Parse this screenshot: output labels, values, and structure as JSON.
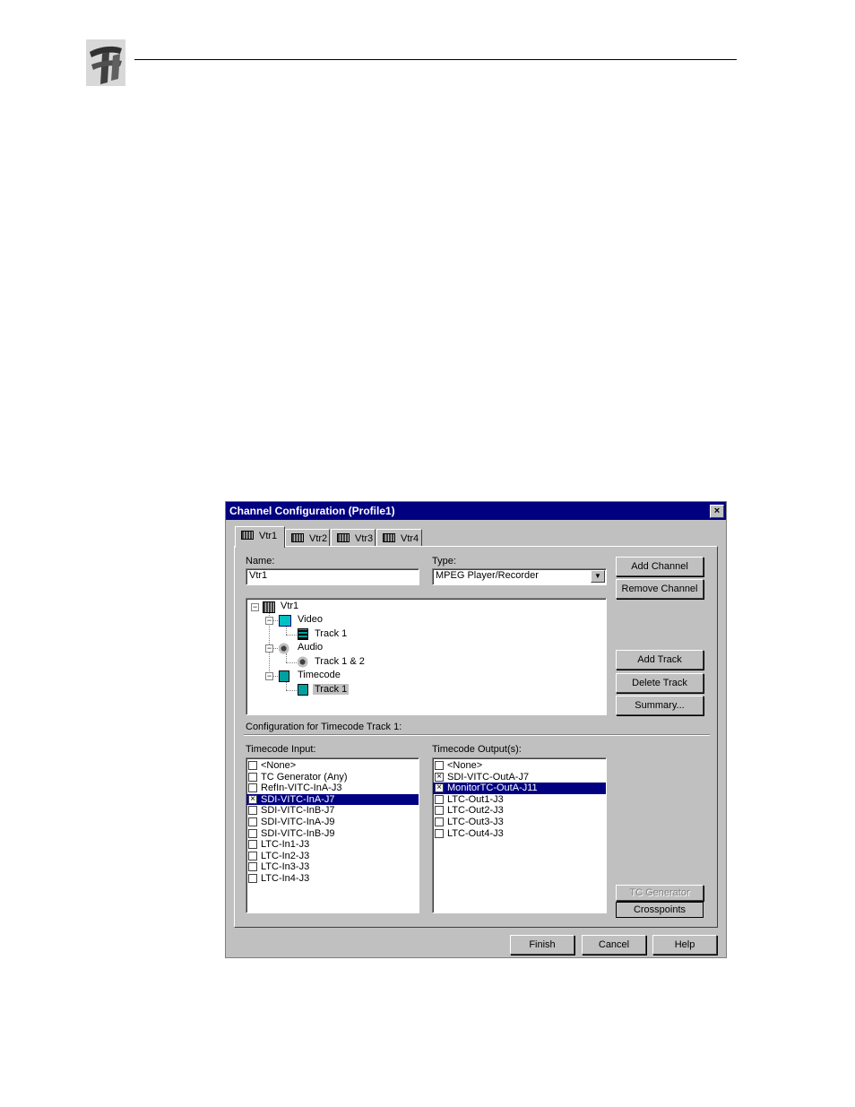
{
  "dialog": {
    "title": "Channel Configuration (Profile1)",
    "close_glyph": "×",
    "tabs": [
      {
        "label": "Vtr1",
        "active": true
      },
      {
        "label": "Vtr2",
        "active": false
      },
      {
        "label": "Vtr3",
        "active": false
      },
      {
        "label": "Vtr4",
        "active": false
      }
    ],
    "name_label": "Name:",
    "name_value": "Vtr1",
    "type_label": "Type:",
    "type_value": "MPEG Player/Recorder",
    "buttons": {
      "add_channel": "Add Channel",
      "remove_channel": "Remove Channel",
      "add_track": "Add Track",
      "delete_track": "Delete Track",
      "summary": "Summary...",
      "tc_generator": "TC Generator",
      "crosspoints": "Crosspoints",
      "finish": "Finish",
      "cancel": "Cancel",
      "help": "Help"
    },
    "tree": {
      "root": "Vtr1",
      "video": "Video",
      "video_track": "Track 1",
      "audio": "Audio",
      "audio_track": "Track 1 & 2",
      "timecode": "Timecode",
      "timecode_track": "Track 1",
      "expander_glyph": "−"
    },
    "config_label": "Configuration for Timecode Track 1:",
    "timecode_input_label": "Timecode Input:",
    "timecode_input_items": [
      {
        "label": "<None>",
        "checked": false,
        "selected": false
      },
      {
        "label": "TC Generator (Any)",
        "checked": false,
        "selected": false
      },
      {
        "label": "RefIn-VITC-InA-J3",
        "checked": false,
        "selected": false
      },
      {
        "label": "SDI-VITC-InA-J7",
        "checked": true,
        "selected": true
      },
      {
        "label": "SDI-VITC-InB-J7",
        "checked": false,
        "selected": false
      },
      {
        "label": "SDI-VITC-InA-J9",
        "checked": false,
        "selected": false
      },
      {
        "label": "SDI-VITC-InB-J9",
        "checked": false,
        "selected": false
      },
      {
        "label": "LTC-In1-J3",
        "checked": false,
        "selected": false
      },
      {
        "label": "LTC-In2-J3",
        "checked": false,
        "selected": false
      },
      {
        "label": "LTC-In3-J3",
        "checked": false,
        "selected": false
      },
      {
        "label": "LTC-In4-J3",
        "checked": false,
        "selected": false
      }
    ],
    "timecode_output_label": "Timecode Output(s):",
    "timecode_output_items": [
      {
        "label": "<None>",
        "checked": false,
        "selected": false
      },
      {
        "label": "SDI-VITC-OutA-J7",
        "checked": true,
        "selected": false
      },
      {
        "label": "MonitorTC-OutA-J11",
        "checked": true,
        "selected": true
      },
      {
        "label": "LTC-Out1-J3",
        "checked": false,
        "selected": false
      },
      {
        "label": "LTC-Out2-J3",
        "checked": false,
        "selected": false
      },
      {
        "label": "LTC-Out3-J3",
        "checked": false,
        "selected": false
      },
      {
        "label": "LTC-Out4-J3",
        "checked": false,
        "selected": false
      }
    ],
    "check_glyph": "×",
    "dropdown_glyph": "▼"
  }
}
